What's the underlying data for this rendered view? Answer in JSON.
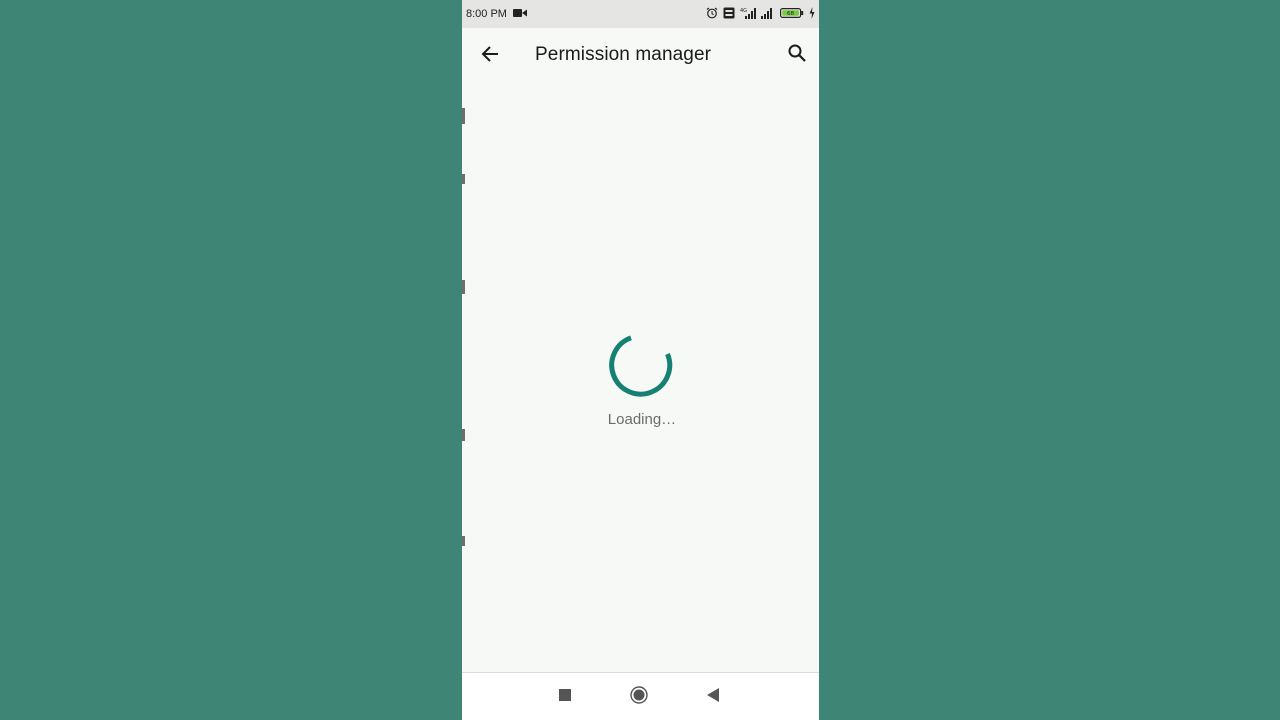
{
  "status_bar": {
    "time": "8:00 PM",
    "icons": [
      "video-camera-icon",
      "alarm-icon",
      "volte-icon",
      "4g-signal-icon",
      "signal-icon",
      "battery-icon",
      "charging-icon"
    ],
    "battery_level": "68",
    "network_label": "4G"
  },
  "app_bar": {
    "title": "Permission manager",
    "back_icon": "arrow-left-icon",
    "search_icon": "search-icon"
  },
  "content": {
    "loading_text": "Loading…",
    "spinner_color": "#168072"
  },
  "nav_bar": {
    "buttons": [
      "recents-square-icon",
      "home-circle-icon",
      "back-triangle-icon"
    ]
  },
  "colors": {
    "background": "#3e8576",
    "screen": "#f6f9f5",
    "accent": "#168072"
  }
}
